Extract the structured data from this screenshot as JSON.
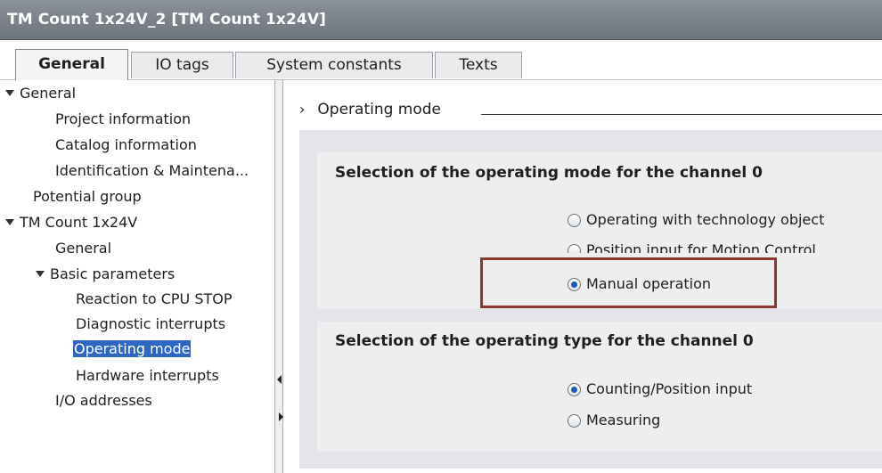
{
  "window": {
    "title": "TM Count 1x24V_2 [TM Count 1x24V]"
  },
  "tabs": [
    {
      "label": "General",
      "active": true
    },
    {
      "label": "IO tags",
      "active": false
    },
    {
      "label": "System constants",
      "active": false
    },
    {
      "label": "Texts",
      "active": false
    }
  ],
  "tree": {
    "items": [
      {
        "label": "General",
        "expanded": true
      },
      {
        "label": "Project information"
      },
      {
        "label": "Catalog information"
      },
      {
        "label": "Identification & Maintena..."
      },
      {
        "label": "Potential group"
      },
      {
        "label": "TM Count 1x24V",
        "expanded": true
      },
      {
        "label": "General"
      },
      {
        "label": "Basic parameters",
        "expanded": true
      },
      {
        "label": "Reaction to CPU STOP"
      },
      {
        "label": "Diagnostic interrupts"
      },
      {
        "label": "Operating mode",
        "selected": true
      },
      {
        "label": "Hardware interrupts"
      },
      {
        "label": "I/O addresses"
      }
    ]
  },
  "main": {
    "section_title": "Operating mode",
    "group1": {
      "title": "Selection of the operating mode for the channel 0",
      "options": [
        {
          "label": "Operating with technology object",
          "checked": false
        },
        {
          "label": "Position input for Motion Control",
          "checked": false
        },
        {
          "label": "Manual operation",
          "checked": true
        }
      ]
    },
    "group2": {
      "title": "Selection of the operating type for the channel 0",
      "options": [
        {
          "label": "Counting/Position input",
          "checked": true
        },
        {
          "label": "Measuring",
          "checked": false
        }
      ]
    }
  },
  "colors": {
    "selection": "#2e67c2",
    "highlight_border": "#8a3a2c",
    "titlebar": "#7b8289"
  }
}
